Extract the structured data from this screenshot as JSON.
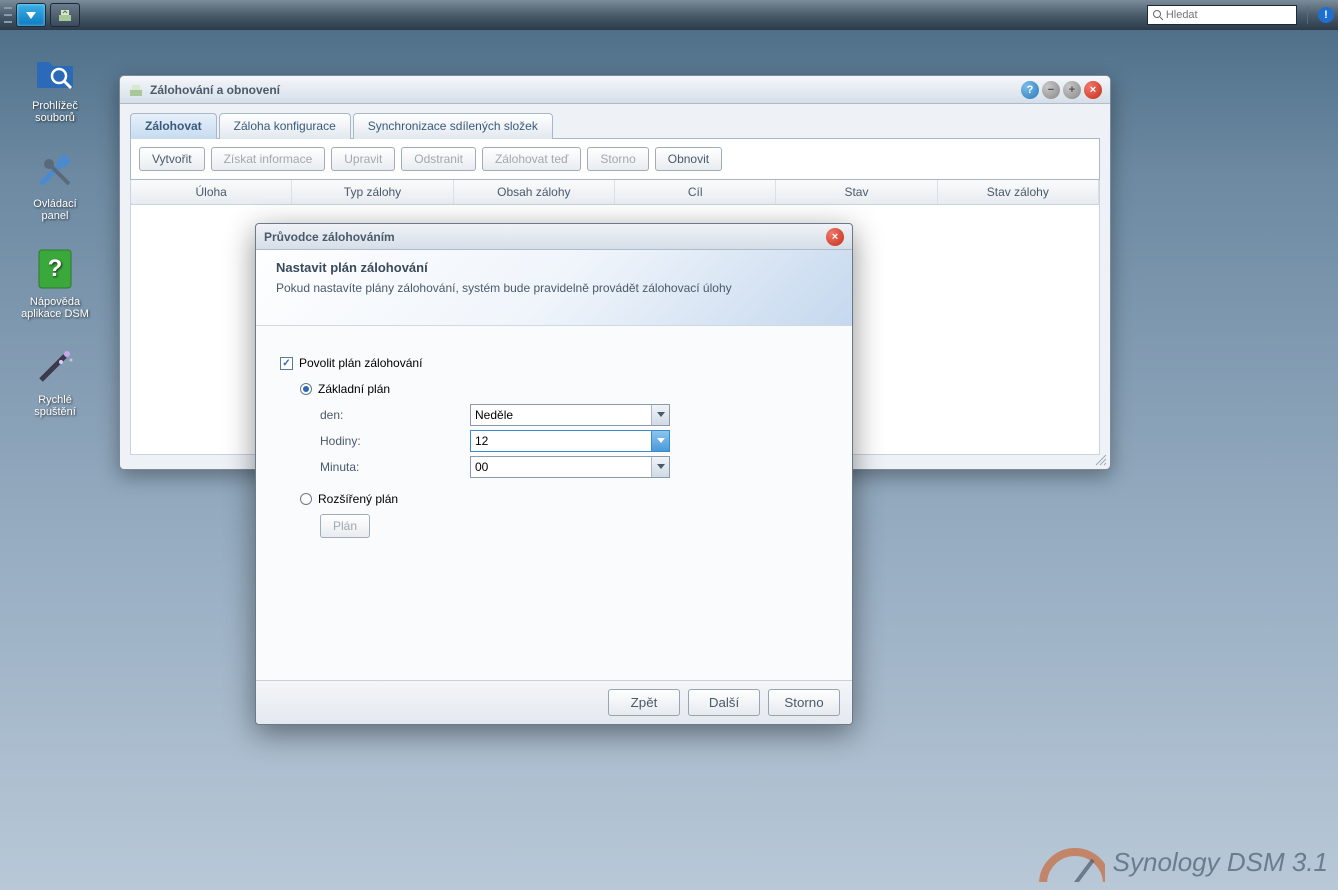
{
  "taskbar": {
    "search_placeholder": "Hledat"
  },
  "desktop": {
    "items": [
      {
        "label": "Prohlížeč souborů",
        "icon": "folder-search"
      },
      {
        "label": "Ovládací panel",
        "icon": "tools"
      },
      {
        "label": "Nápověda aplikace DSM",
        "icon": "help-book"
      },
      {
        "label": "Rychlé spuštění",
        "icon": "wand"
      }
    ]
  },
  "window": {
    "title": "Zálohování a obnovení",
    "tabs": [
      "Zálohovat",
      "Záloha konfigurace",
      "Synchronizace sdílených složek"
    ],
    "toolbar": {
      "create": "Vytvořit",
      "info": "Získat informace",
      "edit": "Upravit",
      "delete": "Odstranit",
      "backup_now": "Zálohovat teď",
      "cancel": "Storno",
      "restore": "Obnovit"
    },
    "columns": [
      "Úloha",
      "Typ zálohy",
      "Obsah zálohy",
      "Cíl",
      "Stav",
      "Stav zálohy"
    ]
  },
  "dialog": {
    "title": "Průvodce zálohováním",
    "banner_title": "Nastavit plán zálohování",
    "banner_desc": "Pokud nastavíte plány zálohování, systém bude pravidelně provádět zálohovací úlohy",
    "enable_label": "Povolit plán zálohování",
    "basic_label": "Základní plán",
    "advanced_label": "Rozšířený plán",
    "day_label": "den:",
    "hour_label": "Hodiny:",
    "minute_label": "Minuta:",
    "day_value": "Neděle",
    "hour_value": "12",
    "minute_value": "00",
    "plan_button": "Plán",
    "back": "Zpět",
    "next": "Další",
    "cancel": "Storno"
  },
  "footer_text": "Synology DSM 3.1"
}
